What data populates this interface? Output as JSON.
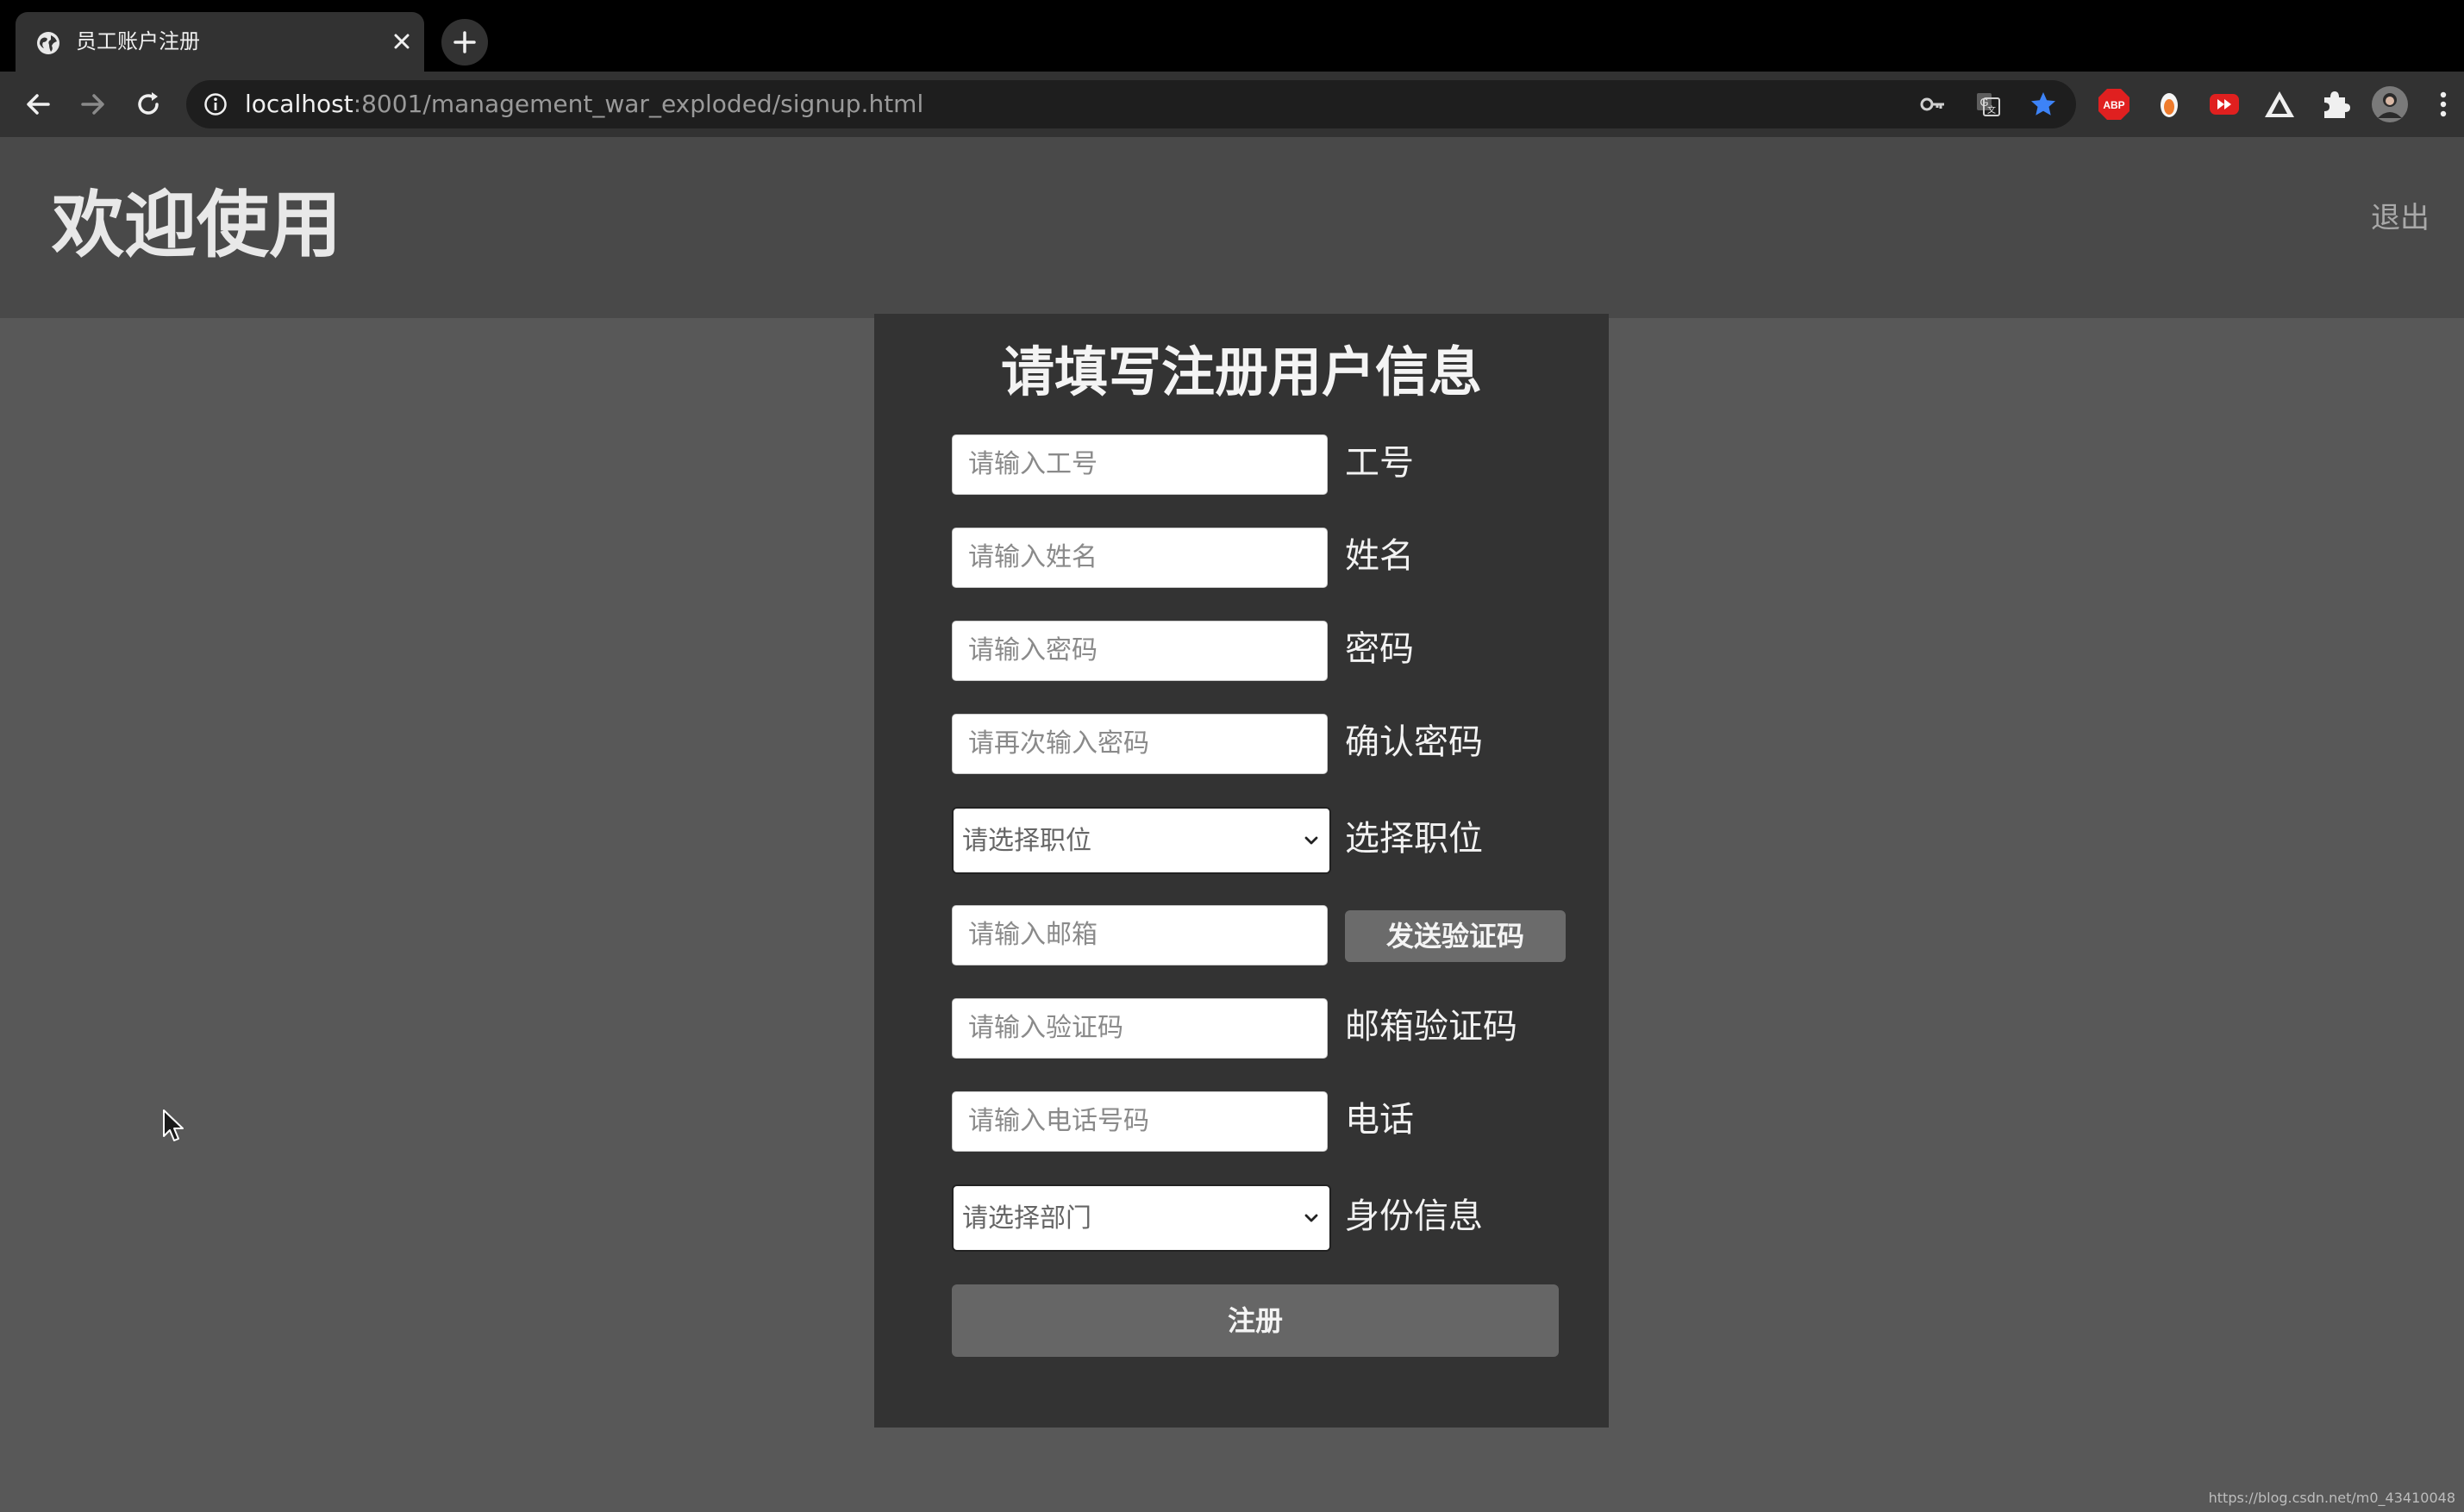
{
  "browser": {
    "tab": {
      "title": "员工账户注册",
      "favicon": "globe-icon"
    },
    "url": {
      "host": "localhost",
      "path": ":8001/management_war_exploded/signup.html"
    },
    "icons": {
      "back": "back-arrow-icon",
      "forward": "forward-arrow-icon",
      "reload": "reload-icon",
      "info": "info-icon",
      "password_key": "key-icon",
      "translate": "translate-icon",
      "bookmark_star": "star-icon",
      "extensions": [
        "adblock-icon",
        "ext-orange-icon",
        "ext-red-video-icon",
        "ext-triangle-icon",
        "puzzle-icon"
      ],
      "profile": "avatar",
      "menu": "kebab-menu-icon"
    },
    "colors": {
      "tabstrip": "#000000",
      "toolbar": "#323232",
      "star": "#3d83f7"
    }
  },
  "header": {
    "welcome": "欢迎使用",
    "logout": "退出"
  },
  "form": {
    "title": "请填写注册用户信息",
    "fields": {
      "employee_id": {
        "placeholder": "请输入工号",
        "label": "工号"
      },
      "name": {
        "placeholder": "请输入姓名",
        "label": "姓名"
      },
      "password": {
        "placeholder": "请输入密码",
        "label": "密码"
      },
      "confirm_password": {
        "placeholder": "请再次输入密码",
        "label": "确认密码"
      },
      "position": {
        "selected": "请选择职位",
        "label": "选择职位"
      },
      "email": {
        "placeholder": "请输入邮箱"
      },
      "email_code": {
        "placeholder": "请输入验证码",
        "label": "邮箱验证码"
      },
      "phone": {
        "placeholder": "请输入电话号码",
        "label": "电话"
      },
      "department": {
        "selected": "请选择部门",
        "label": "身份信息"
      }
    },
    "send_code_button": "发送验证码",
    "submit_button": "注册"
  },
  "status_url": "https://blog.csdn.net/m0_43410048",
  "colors": {
    "page_bg": "#585858",
    "header_bg": "#494949",
    "panel_bg": "#333333",
    "button_bg": "#666666"
  }
}
